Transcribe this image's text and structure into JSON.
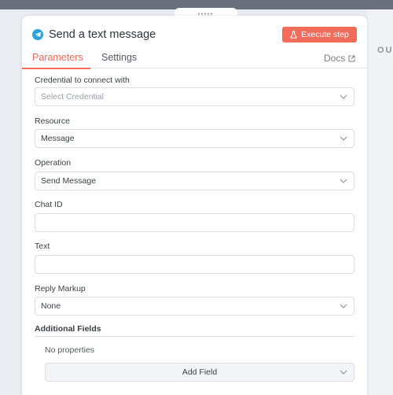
{
  "header": {
    "title": "Send a text message",
    "execute_label": "Execute step"
  },
  "tabs": {
    "parameters": "Parameters",
    "settings": "Settings",
    "docs": "Docs"
  },
  "background": {
    "right_label": "OU"
  },
  "fields": {
    "credential": {
      "label": "Credential to connect with",
      "placeholder": "Select Credential"
    },
    "resource": {
      "label": "Resource",
      "value": "Message"
    },
    "operation": {
      "label": "Operation",
      "value": "Send Message"
    },
    "chat_id": {
      "label": "Chat ID",
      "value": ""
    },
    "text": {
      "label": "Text",
      "value": ""
    },
    "reply_markup": {
      "label": "Reply Markup",
      "value": "None"
    }
  },
  "additional": {
    "title": "Additional Fields",
    "empty_text": "No properties",
    "add_label": "Add Field"
  },
  "colors": {
    "accent": "#f26b5b",
    "telegram": "#2aa3df"
  }
}
